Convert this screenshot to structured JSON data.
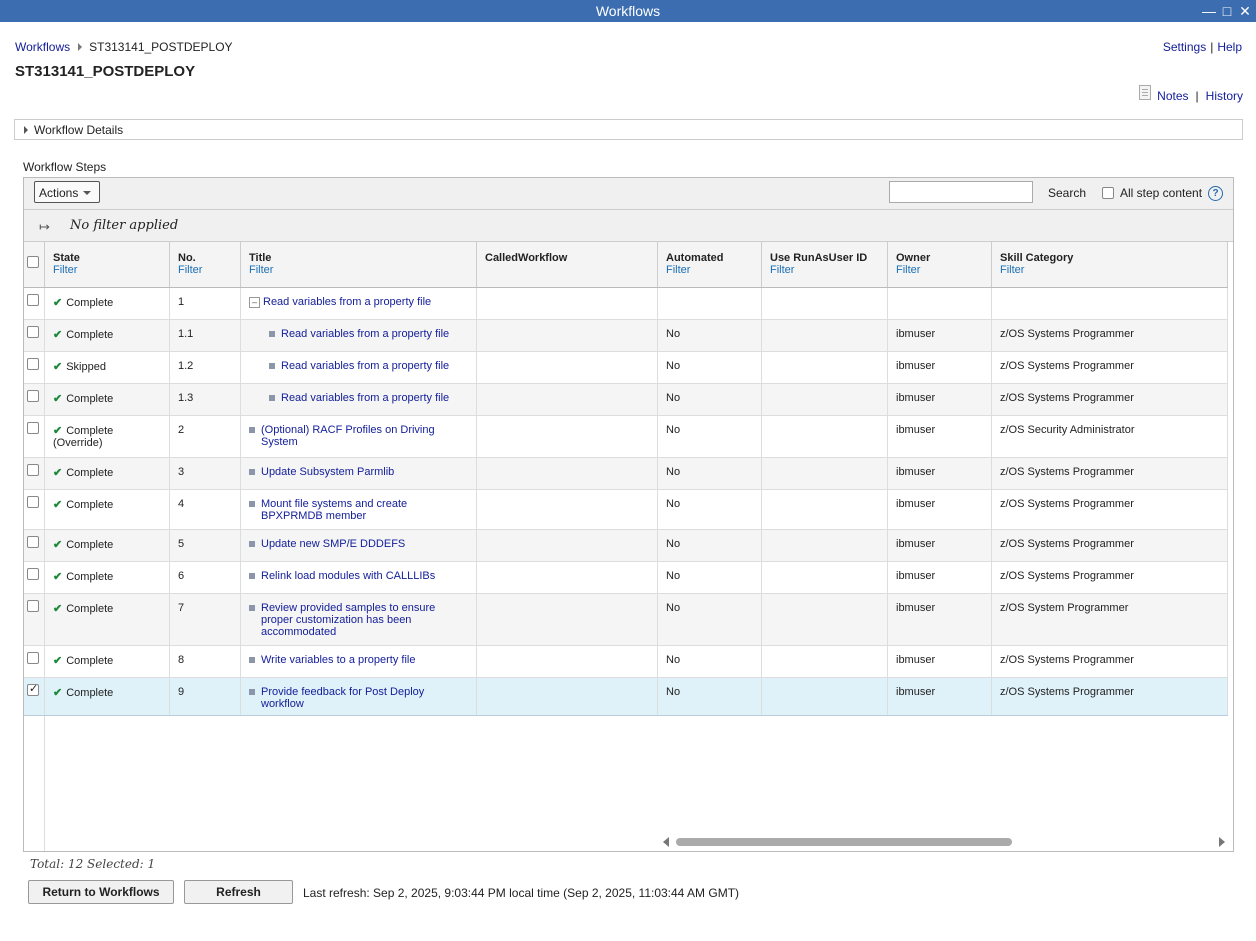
{
  "window": {
    "title": "Workflows"
  },
  "breadcrumb": {
    "root": "Workflows",
    "current": "ST313141_POSTDEPLOY"
  },
  "toplinks": {
    "settings": "Settings",
    "help": "Help",
    "sep": "|"
  },
  "page": {
    "title": "ST313141_POSTDEPLOY"
  },
  "notes": {
    "notes": "Notes",
    "history": "History",
    "sep": "|"
  },
  "details": {
    "label": "Workflow Details"
  },
  "steps": {
    "label": "Workflow Steps"
  },
  "toolbar": {
    "actions": "Actions",
    "search_value": "",
    "search_label": "Search",
    "all_step_content": "All step content",
    "help": "?"
  },
  "filter": {
    "status": "No filter applied"
  },
  "columns": [
    {
      "header": "State",
      "filter": "Filter"
    },
    {
      "header": "No.",
      "filter": "Filter"
    },
    {
      "header": "Title",
      "filter": "Filter"
    },
    {
      "header": "CalledWorkflow",
      "filter": ""
    },
    {
      "header": "Automated",
      "filter": "Filter"
    },
    {
      "header": "Use RunAsUser ID",
      "filter": "Filter"
    },
    {
      "header": "Owner",
      "filter": "Filter"
    },
    {
      "header": "Skill Category",
      "filter": "Filter"
    }
  ],
  "rows": [
    {
      "state": "Complete",
      "state2": "",
      "no": "1",
      "title1": "Read variables from a property file",
      "title2": "",
      "title3": "",
      "automated": "",
      "owner": "",
      "skill": ""
    },
    {
      "state": "Complete",
      "state2": "",
      "no": "1.1",
      "title1": "Read variables from a property file",
      "title2": "",
      "title3": "",
      "automated": "No",
      "owner": "ibmuser",
      "skill": "z/OS Systems Programmer"
    },
    {
      "state": "Skipped",
      "state2": "",
      "no": "1.2",
      "title1": "Read variables from a property file",
      "title2": "",
      "title3": "",
      "automated": "No",
      "owner": "ibmuser",
      "skill": "z/OS Systems Programmer"
    },
    {
      "state": "Complete",
      "state2": "",
      "no": "1.3",
      "title1": "Read variables from a property file",
      "title2": "",
      "title3": "",
      "automated": "No",
      "owner": "ibmuser",
      "skill": "z/OS Systems Programmer"
    },
    {
      "state": "Complete",
      "state2": "(Override)",
      "no": "2",
      "title1": "(Optional) RACF Profiles on Driving",
      "title2": "System",
      "title3": "",
      "automated": "No",
      "owner": "ibmuser",
      "skill": "z/OS Security Administrator"
    },
    {
      "state": "Complete",
      "state2": "",
      "no": "3",
      "title1": "Update Subsystem Parmlib",
      "title2": "",
      "title3": "",
      "automated": "No",
      "owner": "ibmuser",
      "skill": "z/OS Systems Programmer"
    },
    {
      "state": "Complete",
      "state2": "",
      "no": "4",
      "title1": "Mount file systems and create",
      "title2": "BPXPRMDB member",
      "title3": "",
      "automated": "No",
      "owner": "ibmuser",
      "skill": "z/OS Systems Programmer"
    },
    {
      "state": "Complete",
      "state2": "",
      "no": "5",
      "title1": "Update new SMP/E DDDEFS",
      "title2": "",
      "title3": "",
      "automated": "No",
      "owner": "ibmuser",
      "skill": "z/OS Systems Programmer"
    },
    {
      "state": "Complete",
      "state2": "",
      "no": "6",
      "title1": "Relink load modules with CALLLIBs",
      "title2": "",
      "title3": "",
      "automated": "No",
      "owner": "ibmuser",
      "skill": "z/OS Systems Programmer"
    },
    {
      "state": "Complete",
      "state2": "",
      "no": "7",
      "title1": "Review provided samples to ensure",
      "title2": "proper customization has been",
      "title3": "accommodated",
      "automated": "No",
      "owner": "ibmuser",
      "skill": "z/OS System Programmer"
    },
    {
      "state": "Complete",
      "state2": "",
      "no": "8",
      "title1": "Write variables to a property file",
      "title2": "",
      "title3": "",
      "automated": "No",
      "owner": "ibmuser",
      "skill": "z/OS Systems Programmer"
    },
    {
      "state": "Complete",
      "state2": "",
      "no": "9",
      "title1": "Provide feedback for Post Deploy",
      "title2": "workflow",
      "title3": "",
      "automated": "No",
      "owner": "ibmuser",
      "skill": "z/OS Systems Programmer"
    }
  ],
  "footer": {
    "total": "Total: 12 Selected: 1",
    "return_btn": "Return to Workflows",
    "refresh_btn": "Refresh",
    "last_refresh": "Last refresh: Sep 2, 2025, 9:03:44 PM local time (Sep 2, 2025, 11:03:44 AM GMT)"
  }
}
